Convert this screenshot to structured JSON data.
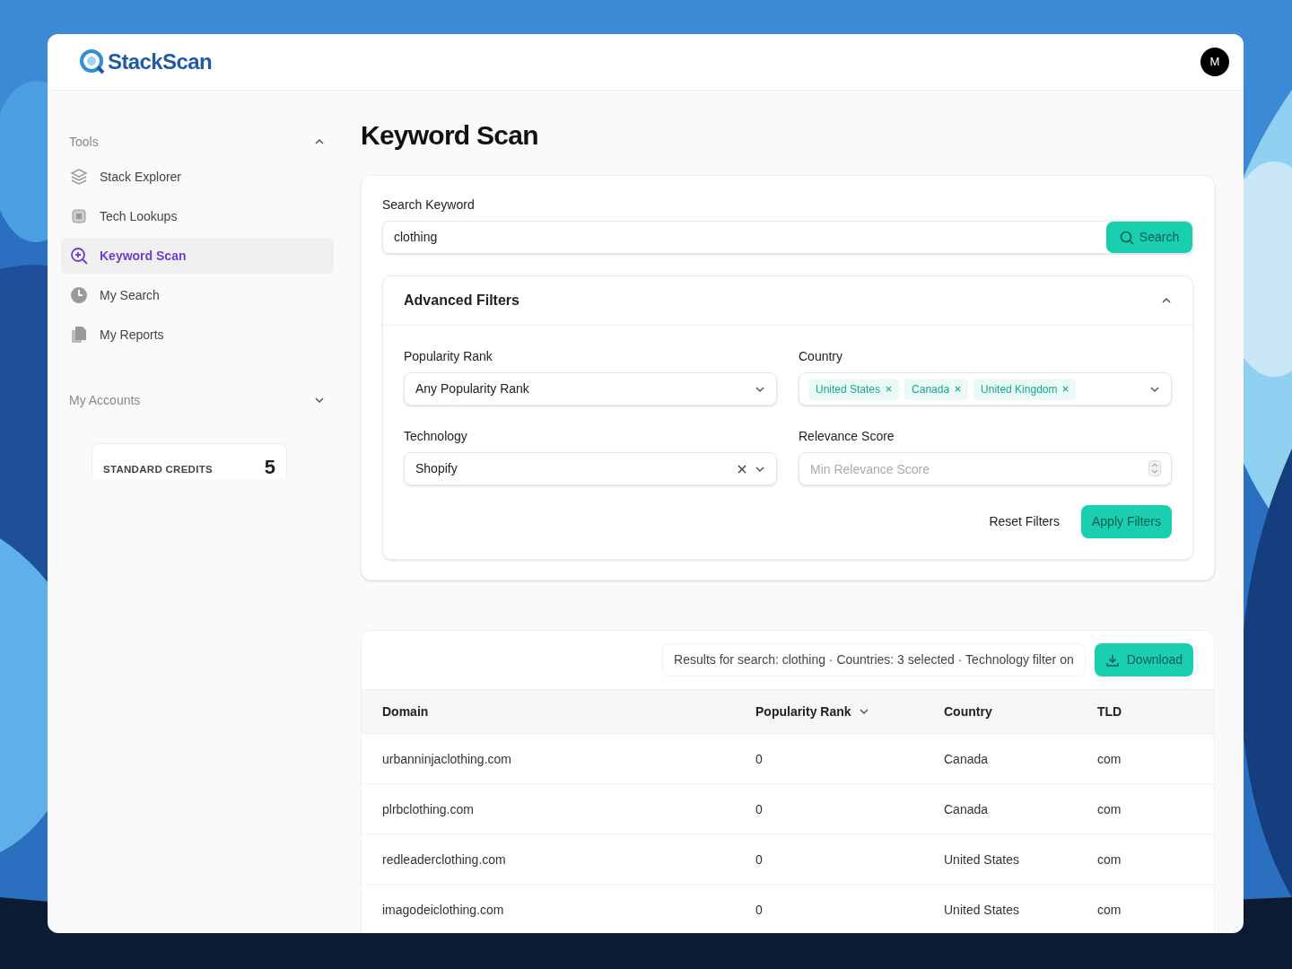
{
  "app": {
    "logo": "StackScan",
    "avatar": "M"
  },
  "sidebar": {
    "sections": [
      {
        "title": "Tools",
        "expanded": true,
        "items": [
          {
            "label": "Stack Explorer",
            "selected": false
          },
          {
            "label": "Tech Lookups",
            "selected": false
          },
          {
            "label": "Keyword Scan",
            "selected": true
          },
          {
            "label": "My Search",
            "selected": false
          },
          {
            "label": "My Reports",
            "selected": false
          }
        ]
      },
      {
        "title": "My Accounts",
        "expanded": false
      }
    ],
    "credits": {
      "label": "STANDARD CREDITS",
      "value": "5"
    }
  },
  "page_title": "Keyword Scan",
  "search": {
    "label": "Search Keyword",
    "value": "clothing",
    "button": "Search"
  },
  "filters": {
    "title": "Advanced Filters",
    "expanded": true,
    "fields": [
      {
        "kind": "select",
        "label": "Popularity Rank",
        "value": "Any Popularity Rank",
        "clearable": false
      },
      {
        "kind": "multiselect",
        "label": "Country",
        "tags": [
          "United States",
          "Canada",
          "United Kingdom"
        ]
      },
      {
        "kind": "select",
        "label": "Technology",
        "value": "Shopify",
        "clearable": true
      },
      {
        "kind": "number",
        "label": "Relevance Score",
        "placeholder": "Min Relevance Score"
      }
    ],
    "reset": "Reset Filters",
    "apply": "Apply Filters"
  },
  "results": {
    "summary": "Results for search: clothing · Countries: 3 selected · Technology filter on",
    "download": "Download",
    "columns": [
      {
        "label": "Domain",
        "sorted": false
      },
      {
        "label": "Popularity Rank",
        "sorted": true
      },
      {
        "label": "Country",
        "sorted": false
      },
      {
        "label": "TLD",
        "sorted": false
      }
    ],
    "rows": [
      [
        "urbanninjaclothing.com",
        "0",
        "Canada",
        "com"
      ],
      [
        "plrbclothing.com",
        "0",
        "Canada",
        "com"
      ],
      [
        "redleaderclothing.com",
        "0",
        "United States",
        "com"
      ],
      [
        "imagodeiclothing.com",
        "0",
        "United States",
        "com"
      ]
    ]
  }
}
